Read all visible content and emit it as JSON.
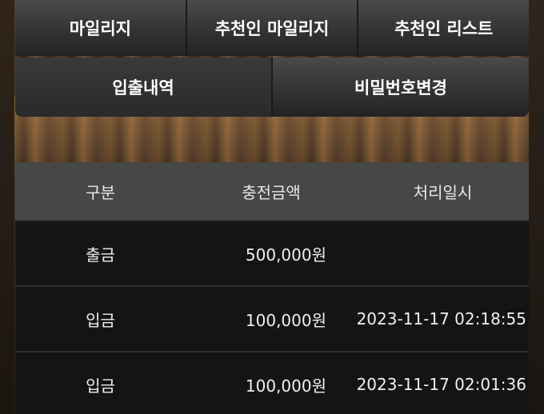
{
  "menu": {
    "row1": [
      "마일리지",
      "추천인 마일리지",
      "추천인 리스트"
    ],
    "row2": [
      "입출내역",
      "비밀번호변경"
    ]
  },
  "table": {
    "headers": [
      "구분",
      "충전금액",
      "처리일시"
    ],
    "rows": [
      {
        "type": "출금",
        "amount": "500,000원",
        "datetime": ""
      },
      {
        "type": "입금",
        "amount": "100,000원",
        "datetime": "2023-11-17 02:18:55"
      },
      {
        "type": "입금",
        "amount": "100,000원",
        "datetime": "2023-11-17 02:01:36"
      }
    ]
  }
}
